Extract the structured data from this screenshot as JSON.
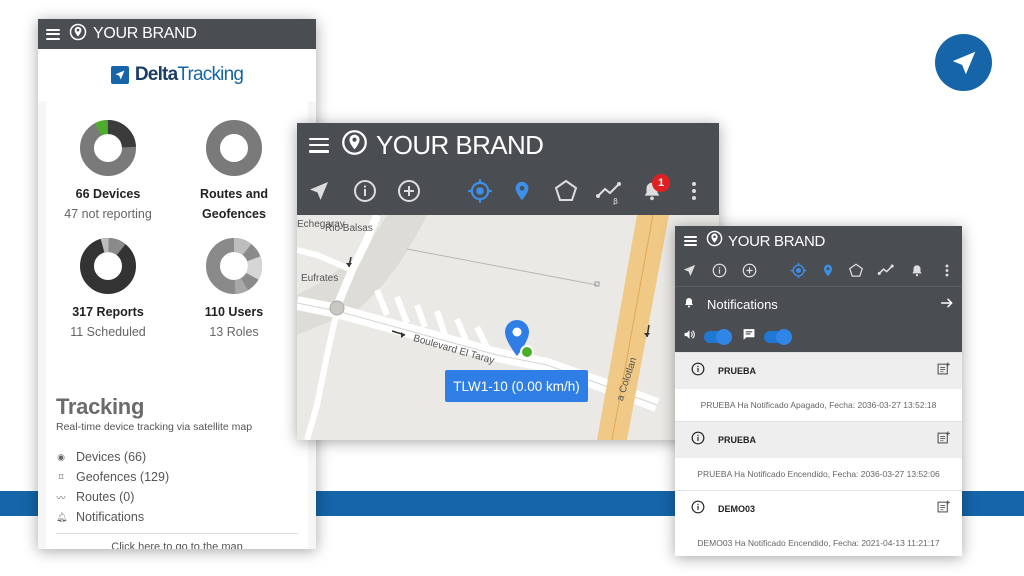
{
  "brand": {
    "name": "YOUR BRAND"
  },
  "logo": {
    "name_part1": "Delta",
    "name_part2": "Tracking"
  },
  "stats": [
    {
      "title": "66 Devices",
      "sub": "47 not reporting"
    },
    {
      "title": "Routes and",
      "sub": "Geofences"
    },
    {
      "title": "317 Reports",
      "sub": "11 Scheduled"
    },
    {
      "title": "110 Users",
      "sub": "13 Roles"
    }
  ],
  "tracking": {
    "title": "Tracking",
    "subtitle": "Real-time device tracking via satellite map",
    "items": [
      "Devices (66)",
      "Geofences (129)",
      "Routes (0)",
      "Notifications"
    ],
    "goto": "Click here to go to the map"
  },
  "map": {
    "badge_count": "1",
    "device_label": "TLW1-10 (0.00 km/h)",
    "streets": [
      "Rio Balsas",
      "Echegaray",
      "Eufrates",
      "Boulevard El Taray",
      "a Colotlan"
    ],
    "beta": "β"
  },
  "notifications": {
    "header": "Notifications",
    "items": [
      {
        "title": "PRUEBA",
        "body": "PRUEBA Ha Notificado Apagado, Fecha: 2036-03-27 13:52:18"
      },
      {
        "title": "PRUEBA",
        "body": "PRUEBA Ha Notificado Encendido, Fecha: 2036-03-27 13:52:06"
      },
      {
        "title": "DEMO03",
        "body": "DEMO03 Ha Notificado Encendido, Fecha: 2021-04-13 11:21:17"
      }
    ]
  },
  "colors": {
    "accent": "#1565a8",
    "bar": "#4a4d52",
    "active_blue": "#2f7ee6",
    "badge": "#e02020",
    "donut_green": "#4caf2a"
  },
  "icons": [
    "menu-icon",
    "location-icon",
    "navigation-icon",
    "info-icon",
    "add-icon",
    "gps-target-icon",
    "map-pin-icon",
    "polygon-icon",
    "route-icon",
    "bell-icon",
    "more-icon",
    "arrow-right-icon",
    "speaker-icon",
    "message-icon",
    "add-note-icon"
  ]
}
